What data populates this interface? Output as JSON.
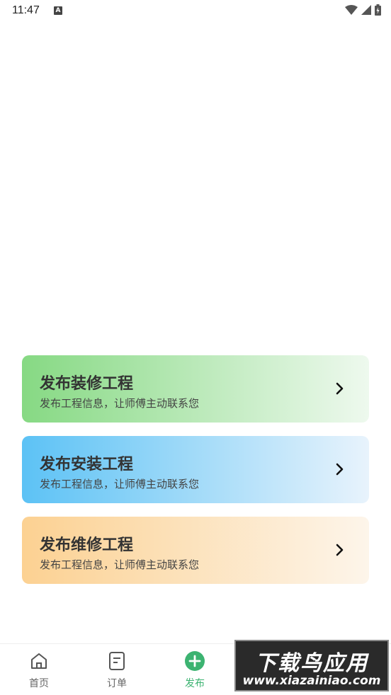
{
  "status_bar": {
    "time": "11:47",
    "notification_icon": "A"
  },
  "cards": [
    {
      "title": "发布装修工程",
      "subtitle": "发布工程信息，让师傅主动联系您",
      "color_start": "#86d983",
      "color_end": "#eef9ee"
    },
    {
      "title": "发布安装工程",
      "subtitle": "发布工程信息，让师傅主动联系您",
      "color_start": "#5cc2f5",
      "color_end": "#e8f3fc"
    },
    {
      "title": "发布维修工程",
      "subtitle": "发布工程信息，让师傅主动联系您",
      "color_start": "#fcd192",
      "color_end": "#fdf5ea"
    }
  ],
  "bottom_nav": {
    "items": [
      {
        "label": "首页",
        "icon": "home-icon"
      },
      {
        "label": "订单",
        "icon": "order-icon"
      },
      {
        "label": "发布",
        "icon": "plus-circle-icon",
        "active": true
      }
    ]
  },
  "watermark": {
    "title": "下载鸟应用",
    "url": "www.xiazainiao.com"
  },
  "colors": {
    "accent": "#3cb371"
  }
}
